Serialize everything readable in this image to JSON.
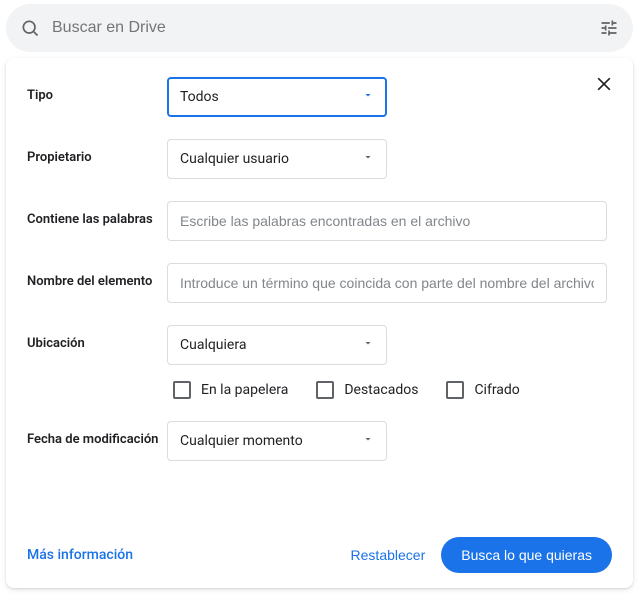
{
  "search": {
    "placeholder": "Buscar en Drive",
    "value": ""
  },
  "filters": {
    "tipo": {
      "label": "Tipo",
      "value": "Todos"
    },
    "propietario": {
      "label": "Propietario",
      "value": "Cualquier usuario"
    },
    "contiene": {
      "label": "Contiene las palabras",
      "placeholder": "Escribe las palabras encontradas en el archivo",
      "value": ""
    },
    "nombre": {
      "label": "Nombre del elemento",
      "placeholder": "Introduce un término que coincida con parte del nombre del archivo",
      "value": ""
    },
    "ubicacion": {
      "label": "Ubicación",
      "value": "Cualquiera",
      "checkboxes": {
        "papelera": "En la papelera",
        "destacados": "Destacados",
        "cifrado": "Cifrado"
      }
    },
    "fecha": {
      "label": "Fecha de modificación",
      "value": "Cualquier momento"
    }
  },
  "footer": {
    "more_info": "Más información",
    "reset": "Restablecer",
    "submit": "Busca lo que quieras"
  }
}
